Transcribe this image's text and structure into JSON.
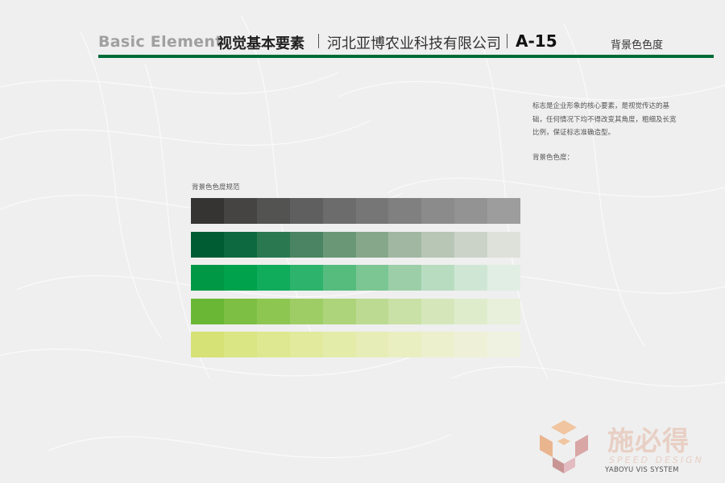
{
  "header": {
    "en_title": "Basic Element",
    "cn_title": "视觉基本要素",
    "company": "河北亚博农业科技有限公司",
    "code": "A-15",
    "section": "背景色色度"
  },
  "description": {
    "text": "标志是企业形象的核心要素，是视觉传达的基础，任何情况下均不得改变其角度，粗细及长宽比例，保证标志准确造型。",
    "label": "背景色色度："
  },
  "swatches": {
    "title": "背景色色度规范",
    "rows": [
      [
        "#353433",
        "#454443",
        "#535352",
        "#5f5f5f",
        "#6c6c6c",
        "#767676",
        "#808080",
        "#8b8b8b",
        "#939393",
        "#9d9d9d"
      ],
      [
        "#005c33",
        "#0d6a40",
        "#2a7850",
        "#4a8462",
        "#6a9877",
        "#87a78b",
        "#a1b7a2",
        "#b8c6b5",
        "#cbd3c9",
        "#dde1da"
      ],
      [
        "#009845",
        "#00a24c",
        "#10ab5b",
        "#2db36b",
        "#55bc7e",
        "#7bc693",
        "#9ccfa8",
        "#b8dcc0",
        "#cfe6d5",
        "#e1eee4"
      ],
      [
        "#6ab735",
        "#7dbf44",
        "#8ec652",
        "#9ecd66",
        "#aed47b",
        "#bcda91",
        "#c9e1a6",
        "#d5e7ba",
        "#dfeccc",
        "#e8f0dc"
      ],
      [
        "#d6e276",
        "#dae684",
        "#dee890",
        "#e1ea9d",
        "#e4ecaa",
        "#e7edb6",
        "#eaefc2",
        "#ecf0cd",
        "#eef1d8",
        "#f0f2e1"
      ]
    ]
  },
  "logo": {
    "cn": "施必得",
    "en": "SPEED DESIGN",
    "mark_colors": [
      "#f0c5a0",
      "#e9b58f",
      "#d9a6a6",
      "#c89595",
      "#e2bcc0"
    ]
  },
  "footer": {
    "text": "YABOYU VIS SYSTEM"
  },
  "colors": {
    "accent": "#006b37",
    "background": "#efefef"
  }
}
